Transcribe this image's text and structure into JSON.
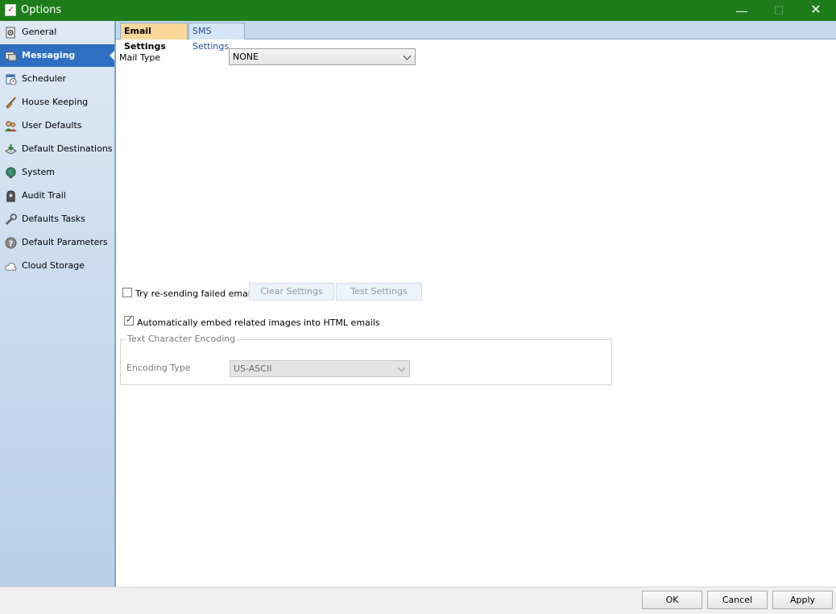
{
  "window": {
    "title": "Options",
    "minimize_glyph": "—",
    "maximize_glyph": "☐",
    "close_glyph": "✕"
  },
  "sidebar": {
    "items": [
      {
        "label": "General",
        "icon": "gear-icon",
        "active": false
      },
      {
        "label": "Messaging",
        "icon": "messaging-icon",
        "active": true
      },
      {
        "label": "Scheduler",
        "icon": "scheduler-icon",
        "active": false
      },
      {
        "label": "House Keeping",
        "icon": "broom-icon",
        "active": false
      },
      {
        "label": "User Defaults",
        "icon": "users-icon",
        "active": false
      },
      {
        "label": "Default Destinations",
        "icon": "destination-icon",
        "active": false
      },
      {
        "label": "System",
        "icon": "globe-icon",
        "active": false
      },
      {
        "label": "Audit Trail",
        "icon": "audit-icon",
        "active": false
      },
      {
        "label": "Defaults Tasks",
        "icon": "tasks-icon",
        "active": false
      },
      {
        "label": "Default Parameters",
        "icon": "help-icon",
        "active": false
      },
      {
        "label": "Cloud Storage",
        "icon": "cloud-icon",
        "active": false
      }
    ]
  },
  "tabs": {
    "email": "Email Settings",
    "sms": "SMS Settings"
  },
  "email": {
    "mail_type_label": "Mail Type",
    "mail_type_value": "NONE",
    "retry_label": "Try re-sending failed emails",
    "retry_checked": false,
    "clear_settings_label": "Clear Settings",
    "test_settings_label": "Test Settings",
    "embed_label": "Automatically embed related images into HTML emails",
    "embed_checked": true,
    "encoding_group_label": "Text Character Encoding",
    "encoding_type_label": "Encoding Type",
    "encoding_type_value": "US-ASCII"
  },
  "footer": {
    "ok_label": "OK",
    "cancel_label": "Cancel",
    "apply_label": "Apply"
  },
  "colors": {
    "titlebar": "#1e7d1a",
    "active_nav": "#2e6fc2",
    "active_tab": "#f9d89a"
  }
}
